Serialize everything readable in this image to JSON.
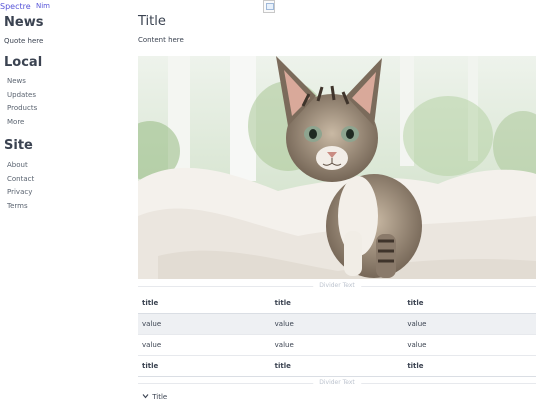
{
  "navbar": {
    "brand": "Spectre",
    "link": "Nim"
  },
  "sidebar": {
    "news_heading": "News",
    "quote": "Quote here",
    "local_heading": "Local",
    "local_items": [
      "News",
      "Updates",
      "Products",
      "More"
    ],
    "site_heading": "Site",
    "site_items": [
      "About",
      "Contact",
      "Privacy",
      "Terms"
    ]
  },
  "main": {
    "title": "Title",
    "content": "Content here",
    "divider_top": "Divider Text",
    "divider_bottom": "Divider Text",
    "accordion_title": "Title"
  },
  "table": {
    "headers": [
      "title",
      "title",
      "title"
    ],
    "rows": [
      [
        "value",
        "value",
        "value"
      ],
      [
        "value",
        "value",
        "value"
      ]
    ],
    "footers": [
      "title",
      "title",
      "title"
    ]
  },
  "colors": {
    "primary": "#5755d9",
    "text": "#3b4351",
    "highlight_row": "#eef0f3"
  }
}
